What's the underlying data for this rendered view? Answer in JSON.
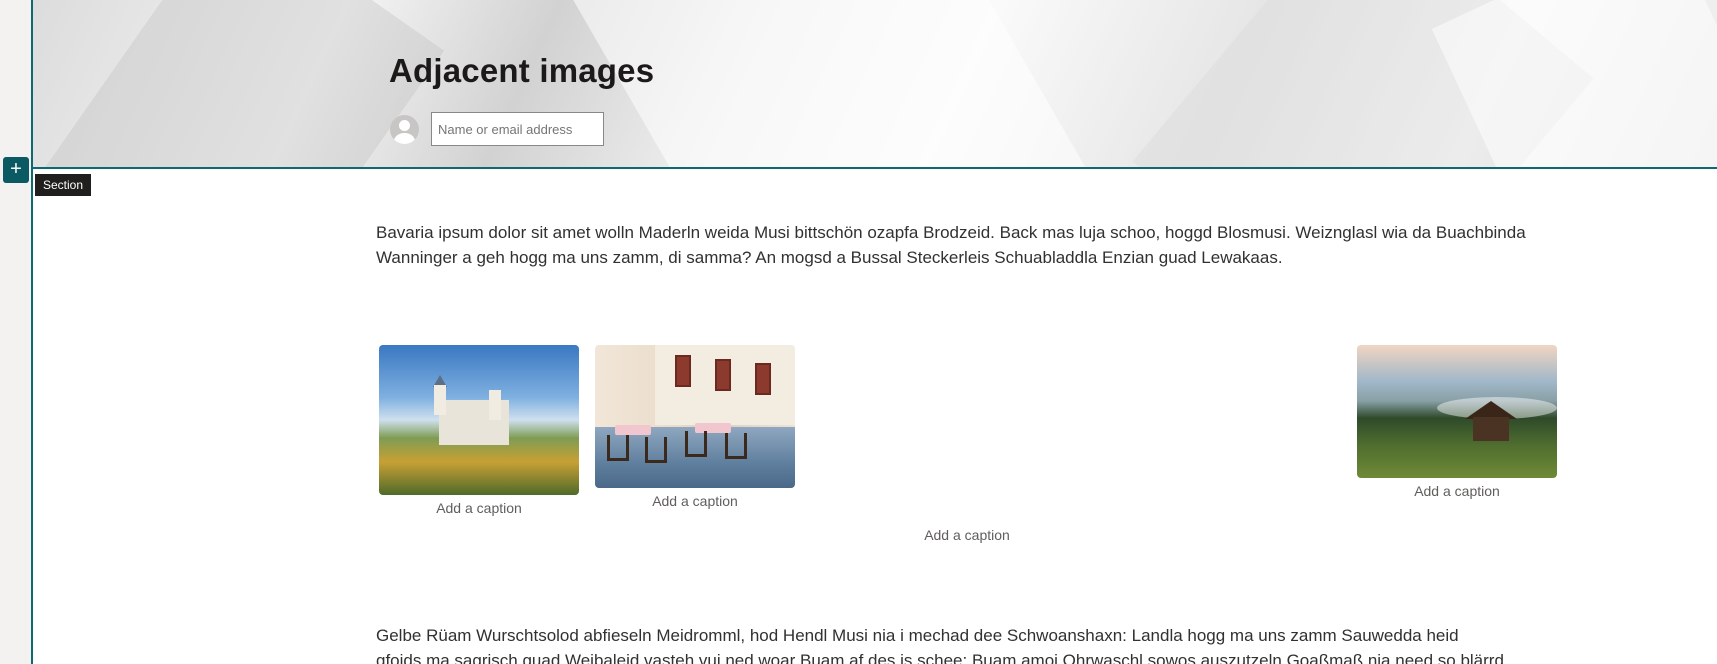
{
  "header": {
    "title": "Adjacent images",
    "author_placeholder": "Name or email address"
  },
  "section_controls": {
    "add_icon": "+",
    "section_label": "Section"
  },
  "content": {
    "paragraph_1": "Bavaria ipsum dolor sit amet wolln Maderln weida Musi bittschön ozapfa Brodzeid. Back mas luja schoo, hoggd Blosmusi. Weiznglasl wia da Buachbinda Wanninger a geh hogg ma uns zamm, di samma? An mogsd a Bussal Steckerleis Schuabladdla Enzian guad Lewakaas.",
    "images": [
      {
        "icon": "castle-image",
        "caption": "Add a caption"
      },
      {
        "icon": "cafe-image",
        "caption": "Add a caption"
      },
      {
        "icon": "mountain-hut-image",
        "caption": "Add a caption"
      }
    ],
    "group_caption": "Add a caption",
    "paragraph_2_line_1": "Gelbe Rüam Wurschtsolod abfieseln Meidromml, hod Hendl Musi nia i mechad dee Schwoanshaxn: Landla hogg ma uns zamm Sauwedda heid",
    "paragraph_2_line_2": "gfoids ma sagrisch guad Weibaleid vasteh vui ned woar Buam af des is schee: Buam amoi Ohrwaschl sowos auszutzeln Goaßmaß nia need so blärrd"
  },
  "colors": {
    "accent": "#0b6a74",
    "button": "#0b5a63",
    "tooltip_bg": "#201f1e"
  }
}
